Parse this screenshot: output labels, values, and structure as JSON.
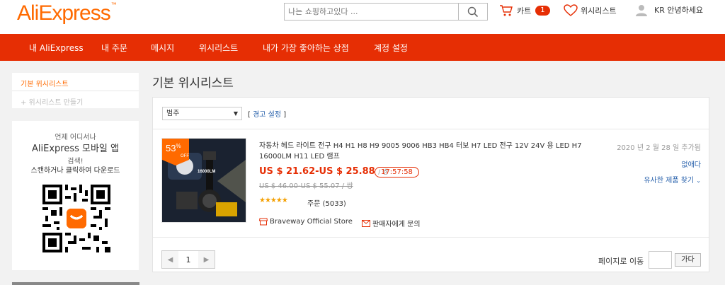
{
  "header": {
    "logo": "AliExpress",
    "logo_mark": "™",
    "search_placeholder": "나는 쇼핑하고있다 ...",
    "cart_label": "카트",
    "cart_count": "1",
    "wishlist_label": "위시리스트",
    "account_label": "KR 안녕하세요"
  },
  "nav": {
    "items": [
      "내 AliExpress",
      "내 주문",
      "메시지",
      "위시리스트",
      "내가 가장 좋아하는 상점",
      "계정 설정"
    ]
  },
  "sidebar": {
    "default_list": "기본 위시리스트",
    "create_list": "+ 위시리스트 만들기"
  },
  "app_promo": {
    "line1": "언제 어디서나",
    "line2": "AliExpress 모바일 앱",
    "line3": "검색!",
    "line4": "스캔하거나 클릭하여 다운로드"
  },
  "main": {
    "title": "기본 위시리스트",
    "sort_selected": "범주",
    "alert_open": "[",
    "alert_label": "경고 설정",
    "alert_close": "]"
  },
  "item": {
    "discount_pct": "53",
    "discount_sym": "%",
    "discount_off": "OFF",
    "thumb_label": "16000LM",
    "name": "자동차 헤드 라이트 전구 H4 H1 H8 H9 9005 9006 HB3 HB4 터보 H7 LED 전구 12V 24V 용 LED H7 16000LM H11 LED 램프",
    "price": "US $ 21.62-US $ 25.88",
    "price_unit": "/ 쌍",
    "timer": "17:57:58",
    "old_price": "US $ 46.00-US $ 55.07 / 쌍",
    "rating": 5,
    "stars": "★★★★★",
    "orders": "주문 (5033)",
    "store": "Braveway Official Store",
    "contact": "판매자에게 문의",
    "added": "2020 년 2 월 28 일 추가됨",
    "remove": "없애다",
    "similar": "유사한 제품 찾기"
  },
  "pager": {
    "current": "1",
    "goto_label": "페이지로 이동",
    "go_button": "가다"
  },
  "colors": {
    "brand": "#e62e04",
    "orange": "#ff6a00",
    "link": "#2962ac"
  }
}
